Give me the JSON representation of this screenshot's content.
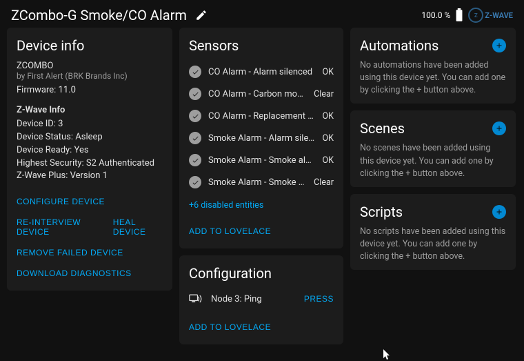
{
  "header": {
    "title": "ZCombo-G Smoke/CO Alarm",
    "battery_pct": "100.0 %",
    "logo": "Z-WAVE"
  },
  "device_info": {
    "title": "Device info",
    "model": "ZCOMBO",
    "manufacturer": "by First Alert (BRK Brands Inc)",
    "firmware_label": "Firmware: 11.0",
    "zwave_heading": "Z-Wave Info",
    "lines": {
      "device_id": "Device ID: 3",
      "device_status": "Device Status: Asleep",
      "device_ready": "Device Ready: Yes",
      "highest_security": "Highest Security: S2 Authenticated",
      "zwave_plus": "Z-Wave Plus: Version 1"
    },
    "actions": {
      "configure": "CONFIGURE DEVICE",
      "reinterview": "RE-INTERVIEW DEVICE",
      "heal": "HEAL DEVICE",
      "remove_failed": "REMOVE FAILED DEVICE",
      "download_diag": "DOWNLOAD DIAGNOSTICS"
    }
  },
  "sensors": {
    "title": "Sensors",
    "items": [
      {
        "name": "CO Alarm - Alarm silenced",
        "state": "OK"
      },
      {
        "name": "CO Alarm - Carbon monoxide …",
        "state": "Clear"
      },
      {
        "name": "CO Alarm - Replacement require…",
        "state": "OK"
      },
      {
        "name": "Smoke Alarm - Alarm silenced",
        "state": "OK"
      },
      {
        "name": "Smoke Alarm - Smoke alarm test",
        "state": "OK"
      },
      {
        "name": "Smoke Alarm - Smoke detected",
        "state": "Clear"
      }
    ],
    "disabled_link": "+6 disabled entities",
    "add_lovelace": "ADD TO LOVELACE"
  },
  "configuration": {
    "title": "Configuration",
    "item_name": "Node 3: Ping",
    "press": "PRESS",
    "add_lovelace": "ADD TO LOVELACE"
  },
  "automations": {
    "title": "Automations",
    "empty": "No automations have been added using this device yet. You can add one by clicking the + button above."
  },
  "scenes": {
    "title": "Scenes",
    "empty": "No scenes have been added using this device yet. You can add one by clicking the + button above."
  },
  "scripts": {
    "title": "Scripts",
    "empty": "No scripts have been added using this device yet. You can add one by clicking the + button above."
  }
}
